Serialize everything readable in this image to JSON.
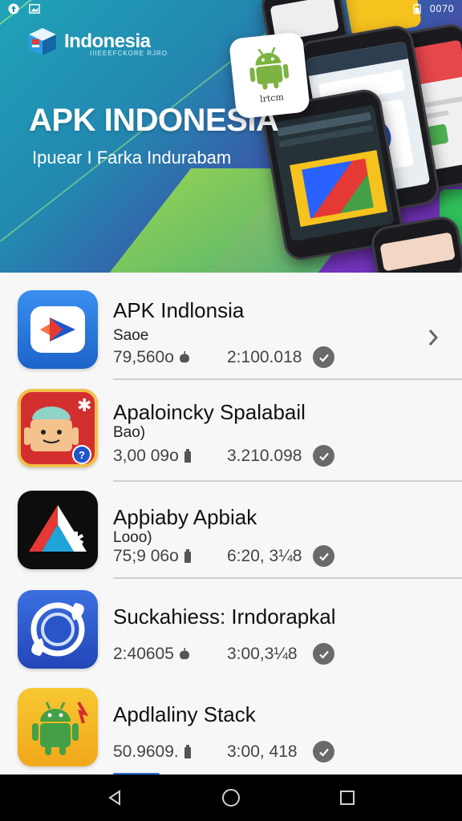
{
  "status_bar": {
    "time": "0070"
  },
  "brand": {
    "name": "Indonesia",
    "tagline": "IIIEEEFCKORE RJRO"
  },
  "banner": {
    "title": "APK INDONESIA",
    "subtitle": "Ipuear I Farka Indurabam",
    "robot_caption": "lrtcm"
  },
  "apps": [
    {
      "name": "APK Indlonsia",
      "subtitle": "Saoe",
      "stat1": "79,560o",
      "stat2": "2:100.018",
      "has_chevron": true
    },
    {
      "name": "Apaloincky Spalabail",
      "subtitle": "Bao)",
      "stat1": "3,00 09o",
      "stat2": "3.210.098"
    },
    {
      "name": "Apþiaby Apbiak",
      "subtitle": "Looo)",
      "stat1": "75;9 06o",
      "stat2": "6:20, 3¼8"
    },
    {
      "name": "Suckahiess: Irndorapkal",
      "subtitle": "",
      "stat1": "2:40605",
      "stat2": "3:00,3¼8"
    },
    {
      "name": "Apdlaliny Stack",
      "subtitle": "",
      "stat1": "50.9609.",
      "stat2": "3:00, 418"
    }
  ],
  "colors": {
    "check_badge": "#6a6a6a",
    "divider": "#cfcfcf",
    "nav_bar": "#000000"
  }
}
